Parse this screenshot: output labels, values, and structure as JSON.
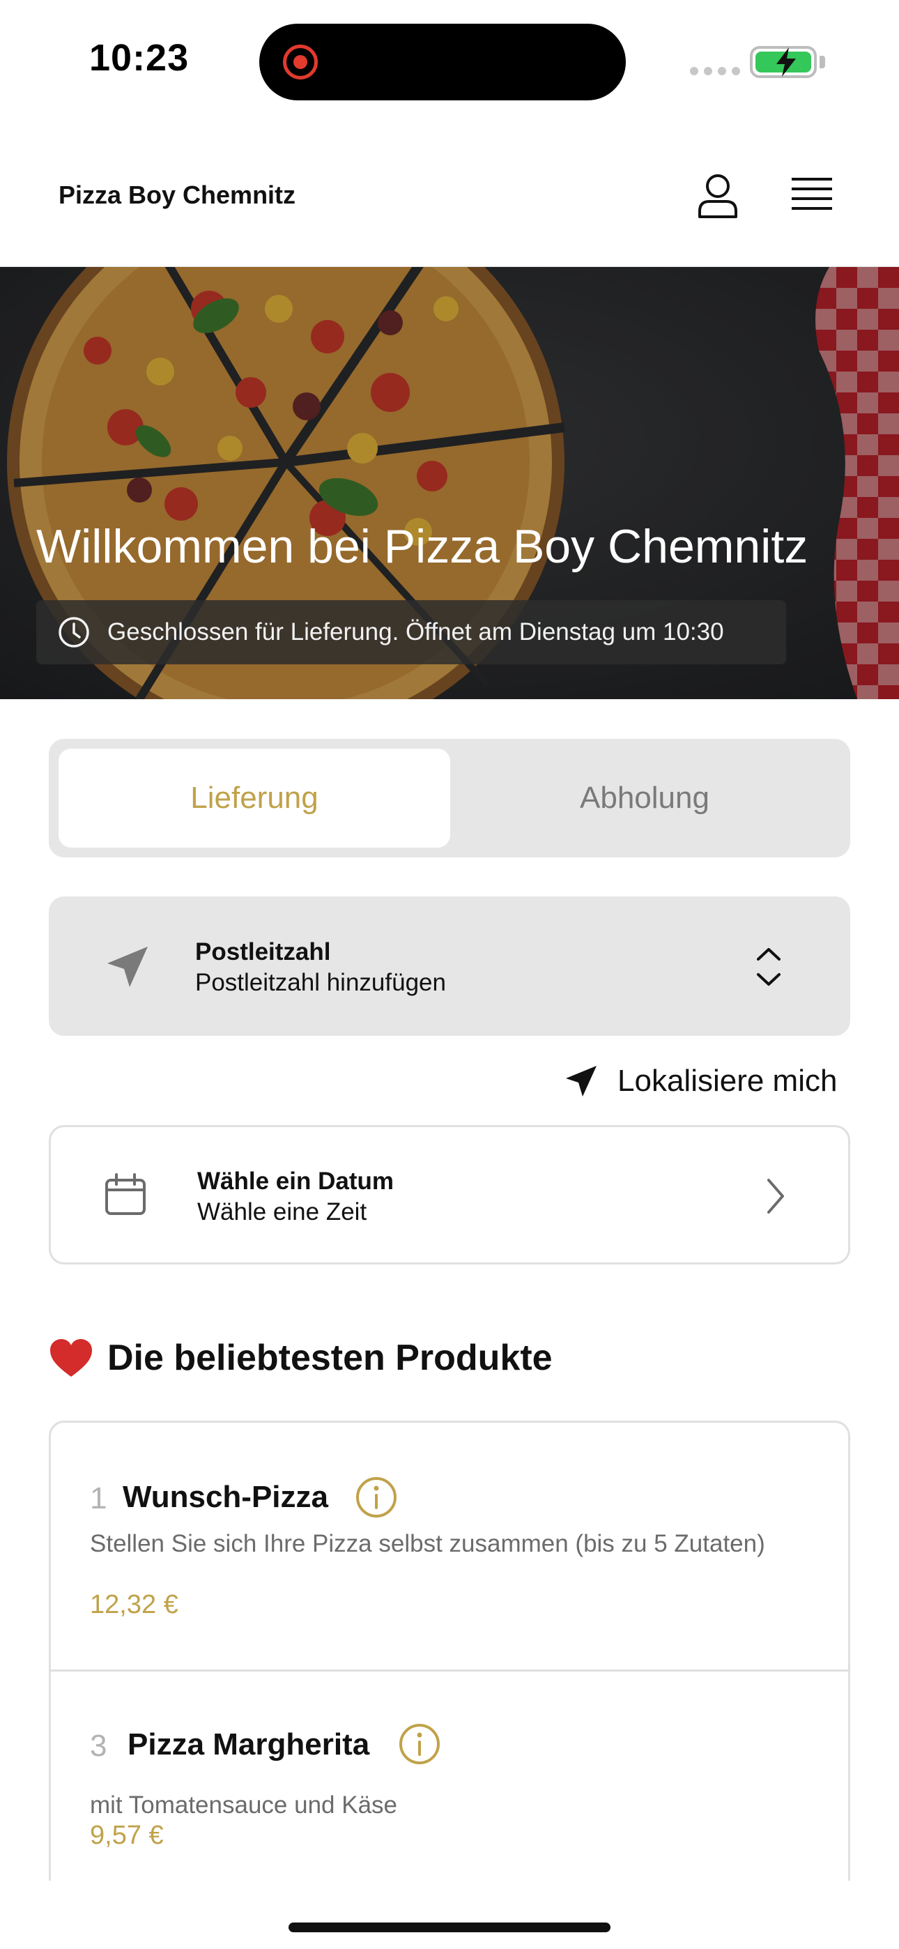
{
  "status_bar": {
    "time": "10:23"
  },
  "header": {
    "brand": "Pizza Boy Chemnitz",
    "icons": [
      "user-icon",
      "menu-icon"
    ]
  },
  "hero": {
    "title": "Willkommen bei Pizza Boy Chemnitz",
    "status": "Geschlossen für Lieferung. Öffnet am Dienstag um 10:30"
  },
  "order_type": {
    "options": [
      "Lieferung",
      "Abholung"
    ],
    "selected": "Lieferung"
  },
  "postcode": {
    "label": "Postleitzahl",
    "placeholder": "Postleitzahl hinzufügen"
  },
  "locate": {
    "label": "Lokalisiere mich"
  },
  "datetime": {
    "date_label": "Wähle ein Datum",
    "time_label": "Wähle eine Zeit"
  },
  "popular": {
    "title": "Die beliebtesten Produkte",
    "products": [
      {
        "number": "1",
        "name": "Wunsch-Pizza",
        "description": "Stellen Sie sich Ihre Pizza selbst zusammen (bis zu 5 Zutaten)",
        "price": "12,32 €"
      },
      {
        "number": "3",
        "name": "Pizza Margherita",
        "description": "mit Tomatensauce und Käse",
        "price": "9,57 €"
      }
    ]
  },
  "colors": {
    "accent": "#c0a24a",
    "segment_bg": "#e6e6e6",
    "battery": "#34c759",
    "record": "#e23a2e"
  }
}
